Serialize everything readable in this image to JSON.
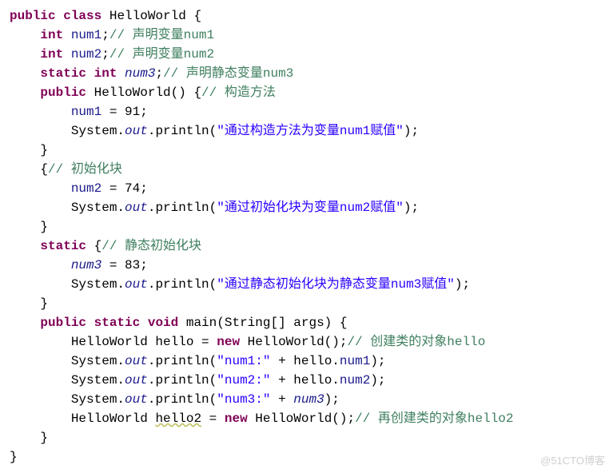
{
  "code": {
    "l1": {
      "kw1": "public",
      "kw2": "class",
      "cls": "HelloWorld",
      "brace": " {"
    },
    "l2": {
      "kw": "int",
      "var": "num1",
      "semi": ";",
      "cm": "// 声明变量num1"
    },
    "l3": {
      "kw": "int",
      "var": "num2",
      "semi": ";",
      "cm": "// 声明变量num2"
    },
    "l4": {
      "kw1": "static",
      "kw2": "int",
      "var": "num3",
      "semi": ";",
      "cm": "// 声明静态变量num3"
    },
    "l5": {
      "kw": "public",
      "ctor": "HelloWorld() {",
      "cm": "// 构造方法"
    },
    "l6": {
      "var": "num1",
      "rest": " = 91;"
    },
    "l7": {
      "sys": "System.",
      "out": "out",
      "pr": ".println(",
      "str": "\"通过构造方法为变量num1赋值\"",
      "end": ");"
    },
    "l8": {
      "brace": "}"
    },
    "l9": {
      "brace": "{",
      "cm": "// 初始化块"
    },
    "l10": {
      "var": "num2",
      "rest": " = 74;"
    },
    "l11": {
      "sys": "System.",
      "out": "out",
      "pr": ".println(",
      "str": "\"通过初始化块为变量num2赋值\"",
      "end": ");"
    },
    "l12": {
      "brace": "}"
    },
    "l13": {
      "kw": "static",
      "brace": " {",
      "cm": "// 静态初始化块"
    },
    "l14": {
      "var": "num3",
      "rest": " = 83;"
    },
    "l15": {
      "sys": "System.",
      "out": "out",
      "pr": ".println(",
      "str": "\"通过静态初始化块为静态变量num3赋值\"",
      "end": ");"
    },
    "l16": {
      "brace": "}"
    },
    "l17": {
      "kw1": "public",
      "kw2": "static",
      "kw3": "void",
      "mname": " main(String[] args) {"
    },
    "l18": {
      "txt1": "HelloWorld hello = ",
      "kw": "new",
      "txt2": " HelloWorld();",
      "cm": "// 创建类的对象hello"
    },
    "l19": {
      "sys": "System.",
      "out": "out",
      "pr": ".println(",
      "str": "\"num1:\"",
      "plus": " + hello.",
      "var": "num1",
      "end": ");"
    },
    "l20": {
      "sys": "System.",
      "out": "out",
      "pr": ".println(",
      "str": "\"num2:\"",
      "plus": " + hello.",
      "var": "num2",
      "end": ");"
    },
    "l21": {
      "sys": "System.",
      "out": "out",
      "pr": ".println(",
      "str": "\"num3:\"",
      "plus": " + ",
      "var": "num3",
      "end": ");"
    },
    "l22": {
      "txt1": "HelloWorld ",
      "hv": "hello2",
      "txt1b": " = ",
      "kw": "new",
      "txt2": " HelloWorld();",
      "cm": "// 再创建类的对象hello2"
    },
    "l23": {
      "brace": "}"
    },
    "l24": {
      "brace": "}"
    }
  },
  "watermark": "@51CTO博客"
}
